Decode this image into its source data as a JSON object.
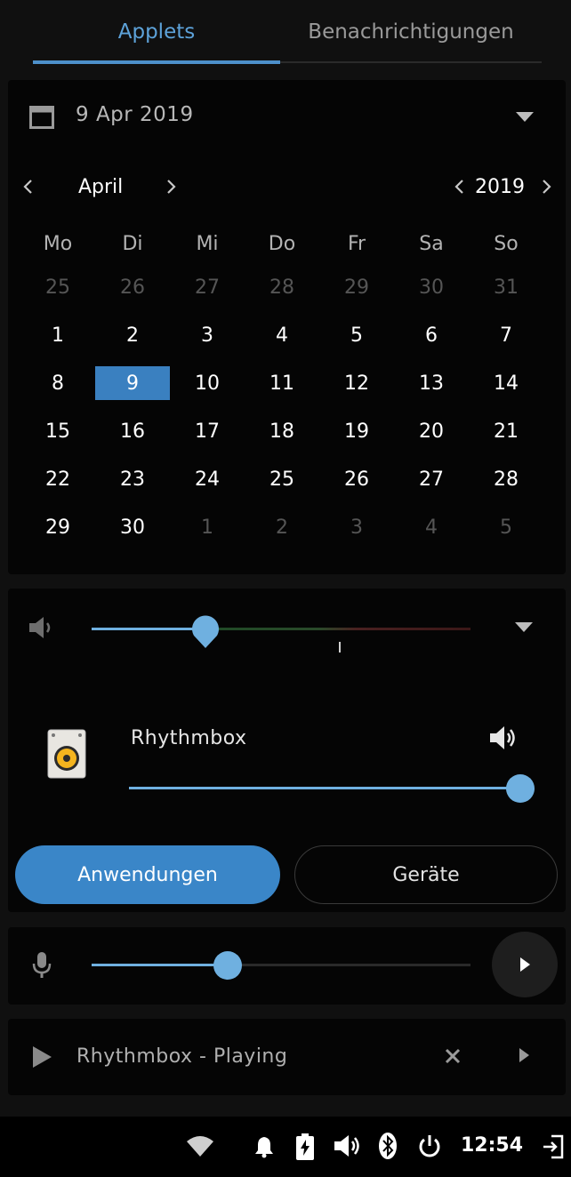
{
  "tabs": [
    {
      "label": "Applets",
      "active": true
    },
    {
      "label": "Benachrichtigungen",
      "active": false
    }
  ],
  "calendar": {
    "selected_date": "9 Apr 2019",
    "month": "April",
    "year": "2019",
    "weekdays": [
      "Mo",
      "Di",
      "Mi",
      "Do",
      "Fr",
      "Sa",
      "So"
    ],
    "weeks": [
      [
        "25",
        "26",
        "27",
        "28",
        "29",
        "30",
        "31"
      ],
      [
        "1",
        "2",
        "3",
        "4",
        "5",
        "6",
        "7"
      ],
      [
        "8",
        "9",
        "10",
        "11",
        "12",
        "13",
        "14"
      ],
      [
        "15",
        "16",
        "17",
        "18",
        "19",
        "20",
        "21"
      ],
      [
        "22",
        "23",
        "24",
        "25",
        "26",
        "27",
        "28"
      ],
      [
        "29",
        "30",
        "1",
        "2",
        "3",
        "4",
        "5"
      ]
    ],
    "today": "9"
  },
  "sound": {
    "master_volume_fraction": 0.3,
    "app_name": "Rhythmbox",
    "app_volume_fraction": 1.0,
    "buttons": {
      "applications": "Anwendungen",
      "devices": "Geräte"
    }
  },
  "microphone": {
    "volume_fraction": 0.36
  },
  "media": {
    "label": "Rhythmbox - Playing"
  },
  "taskbar": {
    "clock": "12:54",
    "icons": [
      "wifi-icon",
      "bell-icon",
      "battery-charging-icon",
      "speaker-icon",
      "bluetooth-icon",
      "power-icon",
      "logout-icon"
    ]
  },
  "colors": {
    "accent": "#4d90cb",
    "slider_fill": "#6fb0e0",
    "button_active": "#3a86c8"
  }
}
